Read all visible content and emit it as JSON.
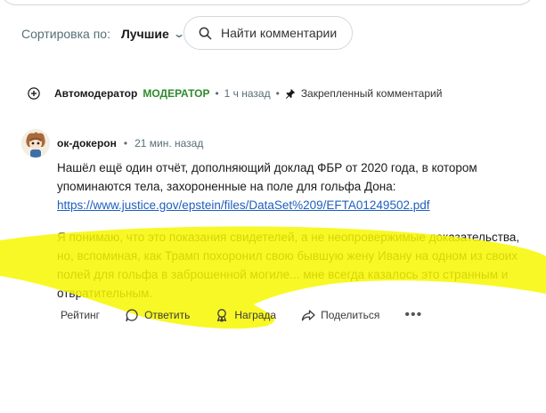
{
  "sort": {
    "label": "Сортировка по:",
    "value": "Лучшие"
  },
  "search": {
    "placeholder": "Найти комментарии"
  },
  "pinned": {
    "author": "Автомодератор",
    "badge": "МОДЕРАТОР",
    "time": "1 ч назад",
    "pinned_label": "Закрепленный комментарий"
  },
  "comment": {
    "author": "ок-докерон",
    "time": "21 мин. назад",
    "paragraph1": "Нашёл ещё один отчёт, дополняющий доклад ФБР от 2020 года, в котором упоминаются тела, захороненные на поле для гольфа Дона:",
    "link": "https://www.justice.gov/epstein/files/DataSet%209/EFTA01249502.pdf",
    "paragraph2": "Я понимаю, что это показания свидетелей, а не неопровержимые доказательства, но, вспоминая, как Трамп похоронил свою бывшую жену Ивану на одном из своих полей для гольфа в заброшенной могиле... мне всегда казалось это странным и отвратительным."
  },
  "actions": {
    "rating": "Рейтинг",
    "reply": "Ответить",
    "award": "Награда",
    "share": "Поделиться",
    "more": "•••"
  },
  "colors": {
    "moderator_green": "#2e8b2e",
    "link_blue": "#1f5fbf",
    "highlighter_yellow": "#f7f700"
  }
}
